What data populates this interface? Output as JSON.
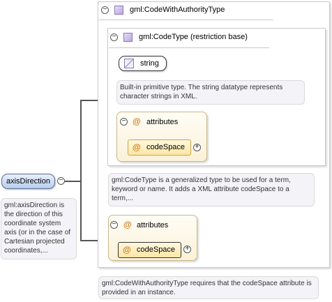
{
  "root_element": {
    "name": "axisDirection",
    "toggle": "−",
    "description": "gml:axisDirection is the direction of this coordinate system axis (or in the case of Cartesian projected coordinates,..."
  },
  "outer_type": {
    "name": "gml:CodeWithAuthorityType",
    "toggle": "−",
    "description": "gml:CodeWithAuthorityType requires that the codeSpace attribute is provided in an instance."
  },
  "inner_type": {
    "name": "gml:CodeType (restriction base)",
    "toggle": "−",
    "description": "gml:CodeType is a generalized type to be used for a term, keyword or name. It adds a XML attribute codeSpace to a term,..."
  },
  "base_type": {
    "name": "string",
    "description": "Built-in primitive type. The string datatype represents character strings in XML."
  },
  "inner_attributes": {
    "toggle": "−",
    "at_symbol": "@",
    "label": "attributes",
    "attribute": {
      "at_symbol": "@",
      "name": "codeSpace",
      "expand": "+"
    }
  },
  "outer_attributes": {
    "toggle": "−",
    "at_symbol": "@",
    "label": "attributes",
    "attribute": {
      "at_symbol": "@",
      "name": "codeSpace",
      "expand": "+"
    }
  },
  "colors": {
    "element_fill": "#b7cdef",
    "attribute_fill": "#fbe6a6",
    "type_icon": "#b9a7df",
    "note_fill": "#f4f4f8",
    "connector": "#555555"
  }
}
